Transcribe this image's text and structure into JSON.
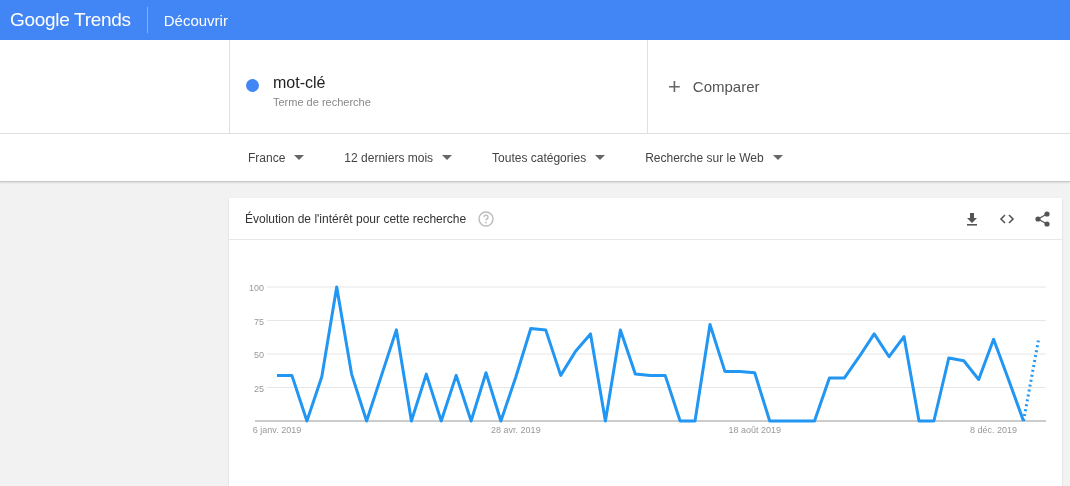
{
  "header": {
    "logo": "Google Trends",
    "nav": "Découvrir"
  },
  "search_term": {
    "term": "mot-clé",
    "subtitle": "Terme de recherche",
    "color": "#4285f4"
  },
  "compare": {
    "icon": "+",
    "label": "Comparer"
  },
  "filters": [
    {
      "label": "France"
    },
    {
      "label": "12 derniers mois"
    },
    {
      "label": "Toutes catégories"
    },
    {
      "label": "Recherche sur le Web"
    }
  ],
  "card": {
    "title": "Évolution de l'intérêt pour cette recherche",
    "chart_data": {
      "type": "line",
      "grid": true,
      "ylim": [
        0,
        100
      ],
      "yticks": [
        25,
        50,
        75,
        100
      ],
      "categories": [
        "6 janv. 2019",
        null,
        null,
        null,
        null,
        null,
        null,
        null,
        null,
        null,
        null,
        null,
        null,
        null,
        null,
        null,
        "28 avr. 2019",
        null,
        null,
        null,
        null,
        null,
        null,
        null,
        null,
        null,
        null,
        null,
        null,
        null,
        null,
        null,
        "18 août 2019",
        null,
        null,
        null,
        null,
        null,
        null,
        null,
        null,
        null,
        null,
        null,
        null,
        null,
        null,
        null,
        "8 déc. 2019",
        null,
        null,
        null
      ],
      "series": [
        {
          "color": "#2196f3",
          "line_style": "solid",
          "values": [
            34,
            34,
            0,
            33,
            100,
            35,
            0,
            34,
            68,
            0,
            35,
            0,
            34,
            0,
            36,
            0,
            33,
            69,
            68,
            34,
            52,
            65,
            0,
            68,
            35,
            34,
            34,
            0,
            0,
            72,
            37,
            37,
            36,
            0,
            0,
            0,
            0,
            32,
            32,
            48,
            65,
            48,
            63,
            0,
            0,
            47,
            45,
            31,
            61,
            31,
            0,
            null
          ]
        },
        {
          "color": "#2196f3",
          "line_style": "dotted",
          "values": [
            null,
            null,
            null,
            null,
            null,
            null,
            null,
            null,
            null,
            null,
            null,
            null,
            null,
            null,
            null,
            null,
            null,
            null,
            null,
            null,
            null,
            null,
            null,
            null,
            null,
            null,
            null,
            null,
            null,
            null,
            null,
            null,
            null,
            null,
            null,
            null,
            null,
            null,
            null,
            null,
            null,
            null,
            null,
            null,
            null,
            null,
            null,
            null,
            null,
            null,
            0,
            60
          ]
        }
      ]
    }
  }
}
